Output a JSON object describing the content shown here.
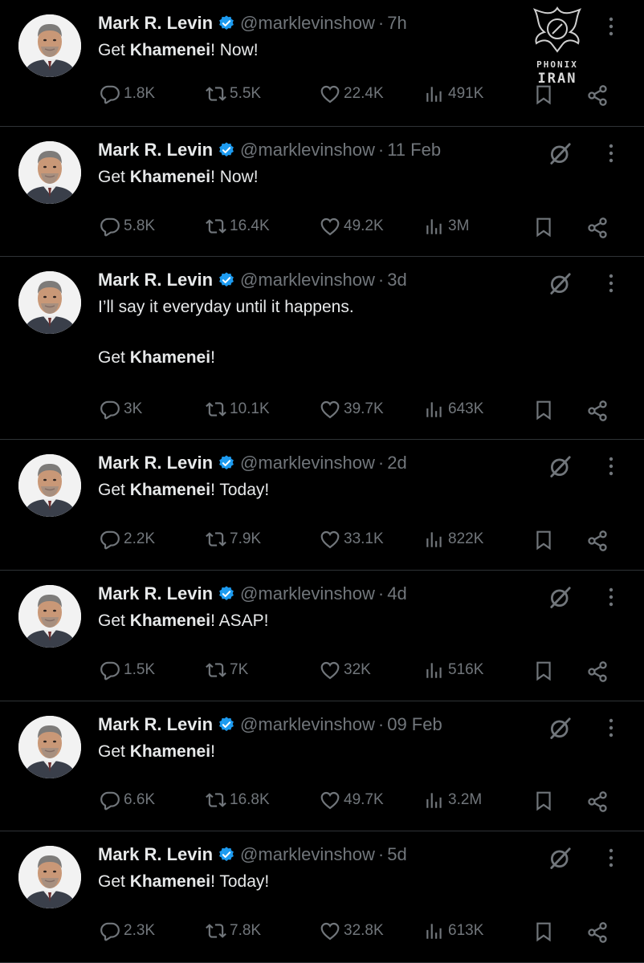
{
  "watermark": {
    "line1": "PHONIX",
    "line2": "IRAN"
  },
  "icons": {
    "reply": "reply-icon",
    "repost": "repost-icon",
    "like": "heart-icon",
    "views": "views-icon",
    "bookmark": "bookmark-icon",
    "share": "share-icon",
    "grok": "grok-icon",
    "more": "more-icon",
    "verified": "verified-badge-icon"
  },
  "colors": {
    "background": "#000000",
    "text": "#e7e9ea",
    "muted": "#71767b",
    "verified": "#1d9bf0",
    "divider": "#2f3336"
  },
  "tweets": [
    {
      "name": "Mark R. Levin",
      "handle": "@marklevinshow",
      "separator": "·",
      "time": "7h",
      "text_prefix": "Get ",
      "text_bold": "Khamenei",
      "text_suffix": "!  Now!",
      "replies": "1.8K",
      "reposts": "5.5K",
      "likes": "22.4K",
      "views": "491K"
    },
    {
      "name": "Mark R. Levin",
      "handle": "@marklevinshow",
      "separator": "·",
      "time": "11 Feb",
      "text_prefix": "Get ",
      "text_bold": "Khamenei",
      "text_suffix": "!  Now!",
      "replies": "5.8K",
      "reposts": "16.4K",
      "likes": "49.2K",
      "views": "3M"
    },
    {
      "name": "Mark R. Levin",
      "handle": "@marklevinshow",
      "separator": "·",
      "time": "3d",
      "text_line1": "I’ll say it everyday until it happens.",
      "text_prefix": "Get ",
      "text_bold": "Khamenei",
      "text_suffix": "!",
      "replies": "3K",
      "reposts": "10.1K",
      "likes": "39.7K",
      "views": "643K"
    },
    {
      "name": "Mark R. Levin",
      "handle": "@marklevinshow",
      "separator": "·",
      "time": "2d",
      "text_prefix": "Get ",
      "text_bold": "Khamenei",
      "text_suffix": "!  Today!",
      "replies": "2.2K",
      "reposts": "7.9K",
      "likes": "33.1K",
      "views": "822K"
    },
    {
      "name": "Mark R. Levin",
      "handle": "@marklevinshow",
      "separator": "·",
      "time": "4d",
      "text_prefix": "Get ",
      "text_bold": "Khamenei",
      "text_suffix": "!  ASAP!",
      "replies": "1.5K",
      "reposts": "7K",
      "likes": "32K",
      "views": "516K"
    },
    {
      "name": "Mark R. Levin",
      "handle": "@marklevinshow",
      "separator": "·",
      "time": "09 Feb",
      "text_prefix": "Get ",
      "text_bold": "Khamenei",
      "text_suffix": "!",
      "replies": "6.6K",
      "reposts": "16.8K",
      "likes": "49.7K",
      "views": "3.2M"
    },
    {
      "name": "Mark R. Levin",
      "handle": "@marklevinshow",
      "separator": "·",
      "time": "5d",
      "text_prefix": "Get ",
      "text_bold": "Khamenei",
      "text_suffix": "! Today!",
      "replies": "2.3K",
      "reposts": "7.8K",
      "likes": "32.8K",
      "views": "613K"
    }
  ]
}
